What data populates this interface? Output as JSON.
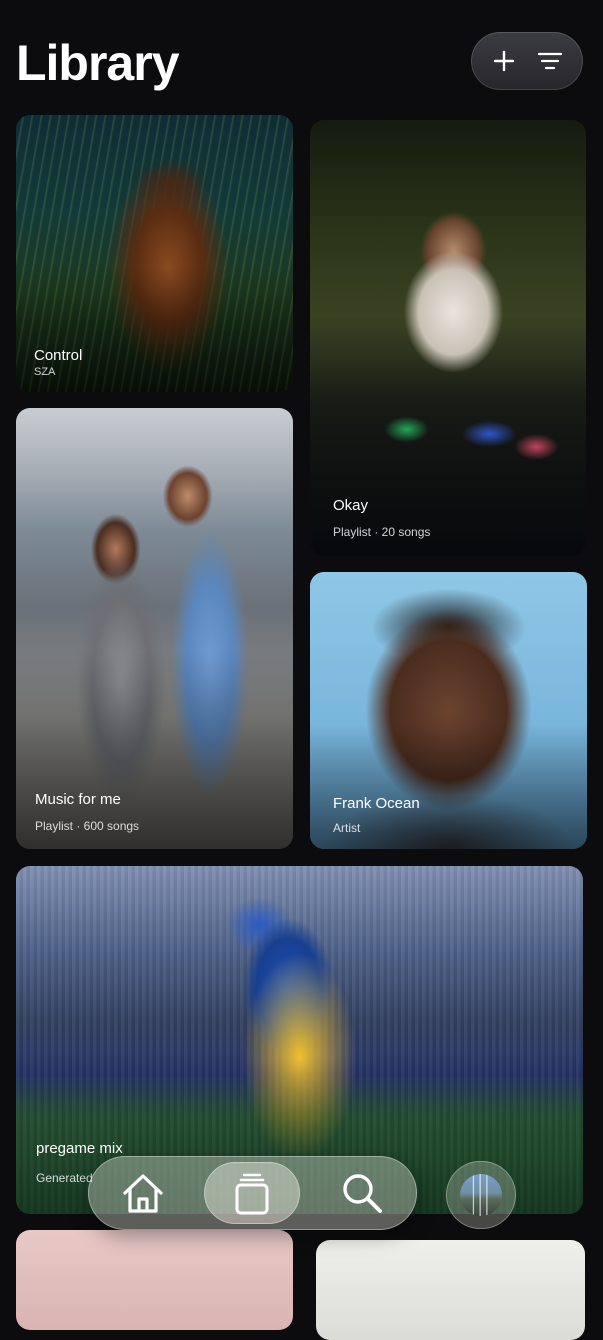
{
  "header": {
    "title": "Library",
    "actions": {
      "add_icon": "plus-icon",
      "sort_icon": "sort-lines-icon"
    }
  },
  "cards": {
    "control": {
      "title": "Control",
      "subtitle": "SZA"
    },
    "okay": {
      "title": "Okay",
      "subtitle": "Playlist · 20 songs"
    },
    "music_for_me": {
      "title": "Music for me",
      "subtitle": "Playlist · 600 songs"
    },
    "frank_ocean": {
      "title": "Frank Ocean",
      "subtitle": "Artist"
    },
    "pregame_mix": {
      "title": "pregame mix",
      "subtitle": "Generated"
    }
  },
  "tabbar": {
    "items": [
      {
        "name": "home",
        "icon": "home-icon",
        "active": false
      },
      {
        "name": "library",
        "icon": "library-icon",
        "active": true
      },
      {
        "name": "search",
        "icon": "search-icon",
        "active": false
      }
    ],
    "now_playing_icon": "album-art-thumbnail"
  }
}
